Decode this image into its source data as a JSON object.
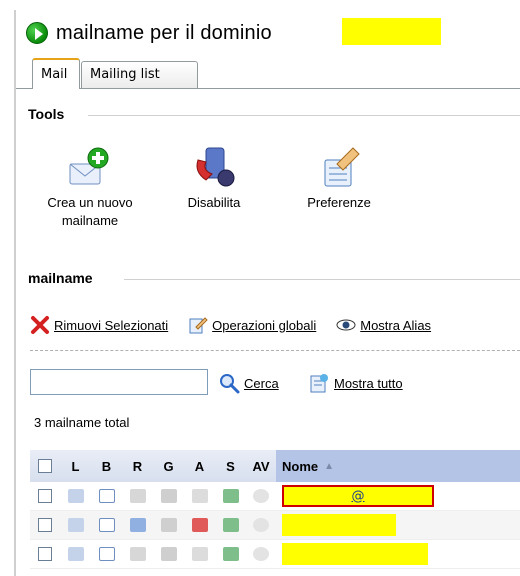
{
  "title": "mailname per il dominio",
  "tabs": [
    {
      "label": "Mail",
      "active": true
    },
    {
      "label": "Mailing list",
      "active": false
    }
  ],
  "tools": {
    "header": "Tools",
    "items": [
      {
        "label_line1": "Crea un nuovo",
        "label_line2": "mailname",
        "icon": "new-mail-icon"
      },
      {
        "label_line1": "Disabilita",
        "label_line2": "",
        "icon": "disable-icon"
      },
      {
        "label_line1": "Preferenze",
        "label_line2": "",
        "icon": "preferences-icon"
      }
    ]
  },
  "mailname_section": {
    "header": "mailname",
    "toolbar": {
      "remove": "Rimuovi Selezionati",
      "global_ops": "Operazioni globali",
      "show_alias": "Mostra Alias"
    }
  },
  "search": {
    "value": "",
    "search_label": "Cerca",
    "show_all_label": "Mostra tutto"
  },
  "total_text": "3 mailname total",
  "table": {
    "columns": [
      "L",
      "B",
      "R",
      "G",
      "A",
      "S",
      "AV",
      "Nome"
    ],
    "sort_indicator": "▲",
    "rows": [
      {
        "name": "@"
      },
      {
        "name": ""
      },
      {
        "name": ""
      }
    ]
  },
  "colors": {
    "highlight": "#ffff00",
    "selection_border": "#d10000",
    "header_bg": "#b4c4e6",
    "tab_accent": "#e6a317"
  }
}
